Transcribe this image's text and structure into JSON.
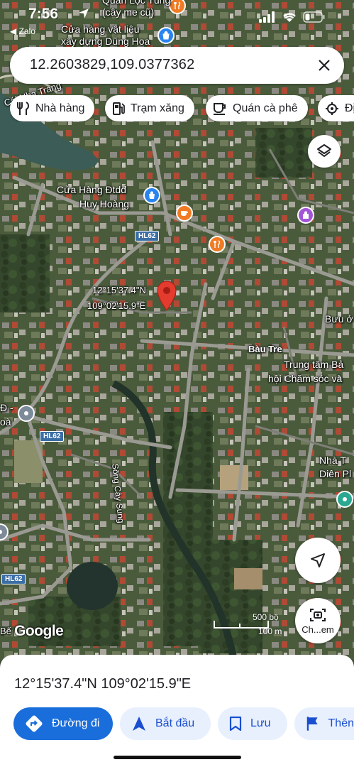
{
  "status_bar": {
    "time": "7:56",
    "back_app": "◀ Zalo"
  },
  "search": {
    "query": "12.2603829,109.0377362"
  },
  "chips": [
    {
      "label": "Nhà hàng",
      "icon": "fork-knife-icon"
    },
    {
      "label": "Trạm xăng",
      "icon": "gas-station-icon"
    },
    {
      "label": "Quán cà phê",
      "icon": "coffee-cup-icon"
    },
    {
      "label": "Đị",
      "icon": "attraction-icon"
    }
  ],
  "map": {
    "labels": {
      "shop_top_1": "Quán Lộc Tùng",
      "shop_top_2": "(cây me cũ)",
      "hardware_1": "Cửa hàng vật liệu",
      "hardware_2": "xây dựng Dũng Hoa",
      "nha_trang": "Cái Nha Trang",
      "phone_shop_1": "Cửa Hàng Đtdđ",
      "phone_shop_2": "Huy Hoàng",
      "pin_coords_1": "12°15'37.4\"N",
      "pin_coords_2": "109°02'15.9\"E",
      "post_office": "Bưu ở",
      "bau_tre": "Bàu Tre",
      "center_1": "Trung tâm Bả",
      "center_2": "hội Chăm sóc và",
      "left_edge_1": "Đ -",
      "left_edge_2": "oà",
      "nha_t_1": "Nhà T",
      "nha_t_2": "Diên Pl",
      "river": "Sông Cây Sung",
      "road_hl62_a": "HL62",
      "road_hl62_b": "HL62",
      "road_hl62_c": "HL62",
      "be": "Bế"
    },
    "scale": {
      "metric": "500 bộ",
      "meters": "100 m"
    },
    "google": "Google",
    "camera_label": "Ch...em"
  },
  "sheet": {
    "coordinates": "12°15'37.4\"N 109°02'15.9\"E",
    "actions": [
      {
        "label": "Đường đi",
        "icon": "directions-icon"
      },
      {
        "label": "Bắt đầu",
        "icon": "navigation-arrow-icon"
      },
      {
        "label": "Lưu",
        "icon": "bookmark-icon"
      },
      {
        "label": "Thên",
        "icon": "flag-icon"
      }
    ]
  },
  "colors": {
    "accent": "#1a6edb",
    "pin": "#e33b2e",
    "poi_orange": "#f07b24",
    "poi_blue": "#2a84f0",
    "poi_purple": "#a355d8"
  }
}
